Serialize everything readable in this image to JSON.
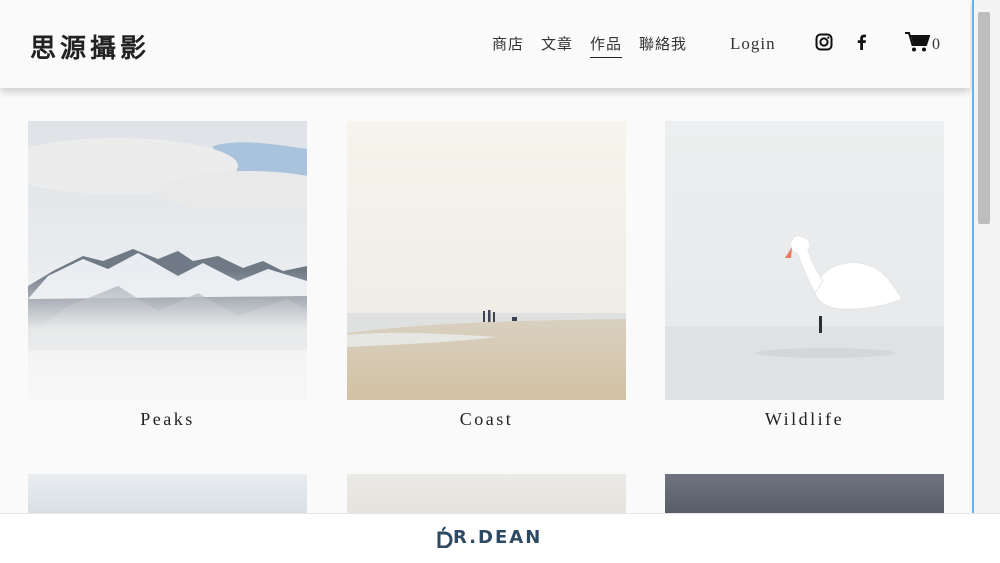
{
  "site": {
    "logo_text": "思源攝影"
  },
  "nav": {
    "items": [
      {
        "label": "商店"
      },
      {
        "label": "文章"
      },
      {
        "label": "作品"
      },
      {
        "label": "聯絡我"
      }
    ],
    "active_index": 2,
    "login_label": "Login",
    "cart_count": "0"
  },
  "gallery": {
    "items": [
      {
        "caption": "Peaks"
      },
      {
        "caption": "Coast"
      },
      {
        "caption": "Wildlife"
      }
    ]
  },
  "footer": {
    "brand_text": "R.DEAN"
  },
  "colors": {
    "accent_scroll": "#63b3f2",
    "brand": "#2e4a63"
  }
}
